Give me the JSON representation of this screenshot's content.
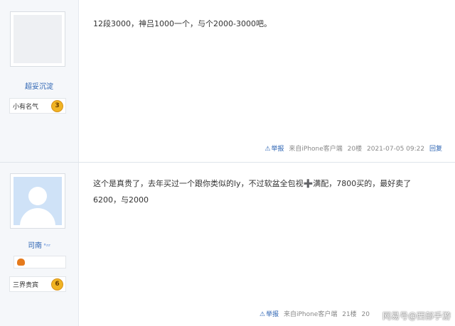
{
  "posts": [
    {
      "username": "超妥沉淀",
      "rank_title": "小有名气",
      "level": "3",
      "content": "12段3000，神吕1000一个，与个2000-3000吧。",
      "footer": {
        "report": "举报",
        "source": "来自iPhone客户端",
        "floor": "20楼",
        "time": "2021-07-05 09:22",
        "reply": "回复"
      }
    },
    {
      "username": "司南",
      "username_suffix": "°ᶻᶻ",
      "rank_title": "三界贵宾",
      "level": "6",
      "content_line1": "这个是真贵了，去年买过一个跟你类似的ly，不过软盆全包视➕满配，7800买的，最好卖了",
      "content_line2": "6200，与2000",
      "footer": {
        "report": "举报",
        "source": "来自iPhone客户端",
        "floor": "21楼",
        "time": "20"
      }
    }
  ],
  "watermark": "网易号@西部手游",
  "icons": {
    "warning": "warning-icon",
    "medal": "medal-icon"
  },
  "colors": {
    "link": "#2d64b3",
    "sidebar_bg": "#f5f7fa",
    "level_badge": "#f0b323"
  }
}
